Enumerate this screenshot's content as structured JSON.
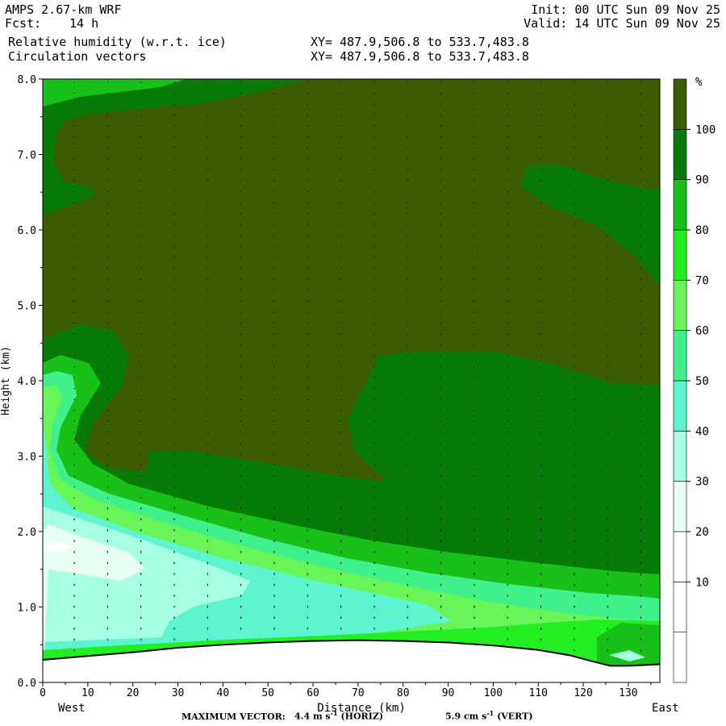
{
  "header": {
    "model": "AMPS 2.67-km WRF",
    "forecast_label": "Fcst:",
    "forecast_hours": "14 h",
    "init": "Init: 00 UTC Sun 09 Nov 25",
    "valid": "Valid: 14 UTC Sun 09 Nov 25",
    "field1": "Relative humidity (w.r.t. ice)",
    "field2": "Circulation vectors",
    "xy1": "XY= 487.9,506.8 to 533.7,483.8",
    "xy2": "XY= 487.9,506.8 to 533.7,483.8"
  },
  "chart_data": {
    "type": "contour cross-section",
    "xlabel": "Distance (km)",
    "ylabel": "Height (km)",
    "x_ticks": [
      "0",
      "10",
      "20",
      "30",
      "40",
      "50",
      "60",
      "70",
      "80",
      "90",
      "100",
      "110",
      "120",
      "130"
    ],
    "y_ticks": [
      "0.0",
      "1.0",
      "2.0",
      "3.0",
      "4.0",
      "5.0",
      "6.0",
      "7.0",
      "8.0"
    ],
    "xlim": [
      0,
      137
    ],
    "ylim": [
      0,
      8
    ],
    "x_end_labels": {
      "left": "West",
      "right": "East"
    },
    "colorbar": {
      "unit": "%",
      "levels": [
        "10",
        "20",
        "30",
        "40",
        "50",
        "60",
        "70",
        "80",
        "90",
        "100"
      ],
      "colors": [
        "#ffffff",
        "#ffffff",
        "#ffffff",
        "#e6fff2",
        "#a7ffe3",
        "#5cf5cf",
        "#40f08a",
        "#68f558",
        "#22ee22",
        "#18c018",
        "#087a08",
        "#3b5c00"
      ]
    },
    "terrain_km": [
      [
        0,
        0.3
      ],
      [
        10,
        0.35
      ],
      [
        20,
        0.4
      ],
      [
        30,
        0.46
      ],
      [
        40,
        0.5
      ],
      [
        50,
        0.53
      ],
      [
        60,
        0.55
      ],
      [
        70,
        0.56
      ],
      [
        80,
        0.55
      ],
      [
        90,
        0.53
      ],
      [
        100,
        0.49
      ],
      [
        110,
        0.43
      ],
      [
        117,
        0.36
      ],
      [
        122,
        0.28
      ],
      [
        126,
        0.22
      ],
      [
        130,
        0.22
      ],
      [
        137,
        0.24
      ]
    ],
    "max_vector": {
      "label": "MAXIMUM VECTOR:",
      "horizontal": "4.4 m s",
      "horizontal_unit": "(HORIZ)",
      "vertical": "5.9 cm s",
      "vertical_unit": "(VERT)",
      "exponent": "-1"
    }
  }
}
